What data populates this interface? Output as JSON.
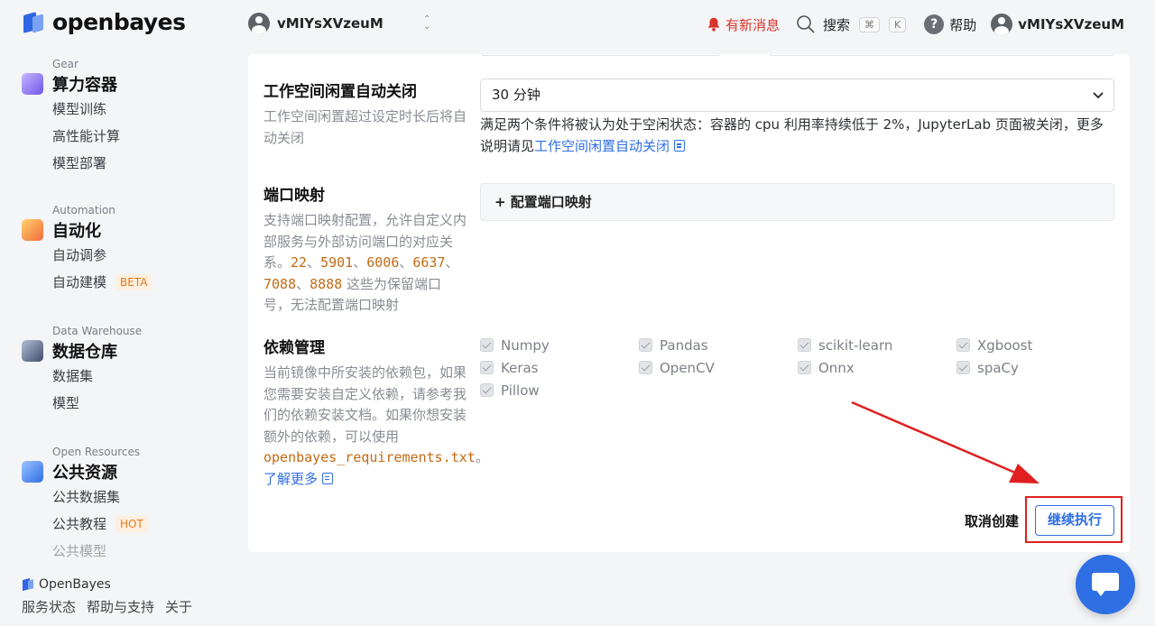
{
  "brand": {
    "name": "openbayes",
    "footer_name": "OpenBayes"
  },
  "workspace": {
    "name": "vMIYsXVzeuM"
  },
  "topbar": {
    "messages_label": "有新消息",
    "search_label": "搜索",
    "shortcut_keys": [
      "⌘",
      "K"
    ],
    "help_label": "帮助",
    "user_name": "vMIYsXVzeuM"
  },
  "sidebar": {
    "sections": [
      {
        "en": "Gear",
        "title": "算力容器",
        "icon": "gear-cube-icon",
        "items": [
          {
            "label": "模型训练"
          },
          {
            "label": "高性能计算"
          },
          {
            "label": "模型部署"
          }
        ]
      },
      {
        "en": "Automation",
        "title": "自动化",
        "icon": "automation-icon",
        "items": [
          {
            "label": "自动调参"
          },
          {
            "label": "自动建模",
            "badge": "BETA"
          }
        ]
      },
      {
        "en": "Data Warehouse",
        "title": "数据仓库",
        "icon": "data-warehouse-icon",
        "items": [
          {
            "label": "数据集"
          },
          {
            "label": "模型"
          }
        ]
      },
      {
        "en": "Open Resources",
        "title": "公共资源",
        "icon": "open-resources-icon",
        "items": [
          {
            "label": "公共数据集"
          },
          {
            "label": "公共教程",
            "badge": "HOT"
          },
          {
            "label": "公共模型"
          }
        ]
      }
    ],
    "footer_links": [
      "服务状态",
      "帮助与支持",
      "关于"
    ]
  },
  "form": {
    "idle": {
      "title": "工作空间闲置自动关闭",
      "desc": "工作空间闲置超过设定时长后将自动关闭",
      "selected": "30 分钟",
      "hint": "满足两个条件将被认为处于空闲状态：容器的 cpu 利用率持续低于 2%，JupyterLab 页面被关闭，更多说明请见",
      "hint_link": "工作空间闲置自动关闭"
    },
    "ports": {
      "title": "端口映射",
      "desc_before": "支持端口映射配置，允许自定义内部服务与外部访问端口的对应关系。",
      "reserved": [
        "22",
        "5901",
        "6006",
        "6637",
        "7088",
        "8888"
      ],
      "desc_after": " 这些为保留端口号，无法配置端口映射",
      "add_button": "+ 配置端口映射"
    },
    "deps": {
      "title": "依赖管理",
      "desc": "当前镜像中所安装的依赖包，如果您需要安装自定义依赖，请参考我们的依赖安装文档。如果你想安装额外的依赖，可以使用",
      "file": "openbayes_requirements.txt",
      "period": "。",
      "learn_more": "了解更多",
      "packages": [
        "Numpy",
        "Pandas",
        "scikit-learn",
        "Xgboost",
        "Keras",
        "OpenCV",
        "Onnx",
        "spaCy",
        "Pillow"
      ]
    },
    "actions": {
      "cancel": "取消创建",
      "continue": "继续执行"
    }
  },
  "colors": {
    "accent": "#2f6fe4",
    "alert": "#d9342b",
    "annotation": "#e02020",
    "code": "#c26a14"
  }
}
